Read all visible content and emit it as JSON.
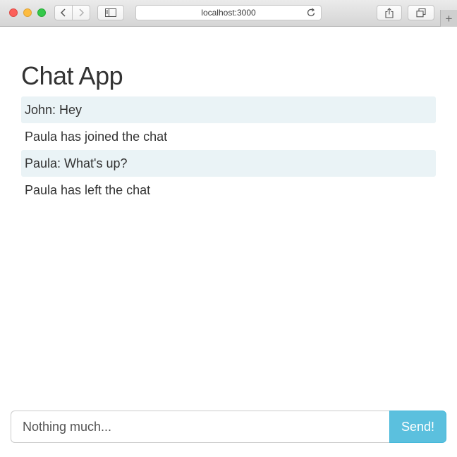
{
  "browser": {
    "url": "localhost:3000",
    "icons": {
      "back": "chevron-left-icon",
      "forward": "chevron-right-icon",
      "sidebar": "sidebar-icon",
      "reload": "reload-icon",
      "share": "share-icon",
      "tabs": "tabs-icon",
      "new_tab": "plus-icon"
    },
    "new_tab_glyph": "+"
  },
  "app": {
    "title": "Chat App",
    "messages": [
      {
        "type": "chat",
        "text": "John: Hey"
      },
      {
        "type": "event",
        "text": "Paula has joined the chat"
      },
      {
        "type": "chat",
        "text": "Paula: What's up?"
      },
      {
        "type": "event",
        "text": "Paula has left the chat"
      }
    ]
  },
  "composer": {
    "value": "Nothing much...",
    "send_label": "Send!"
  },
  "colors": {
    "chat_bubble": "#eaf3f6",
    "send_button": "#5bc0de",
    "text": "#333333"
  }
}
